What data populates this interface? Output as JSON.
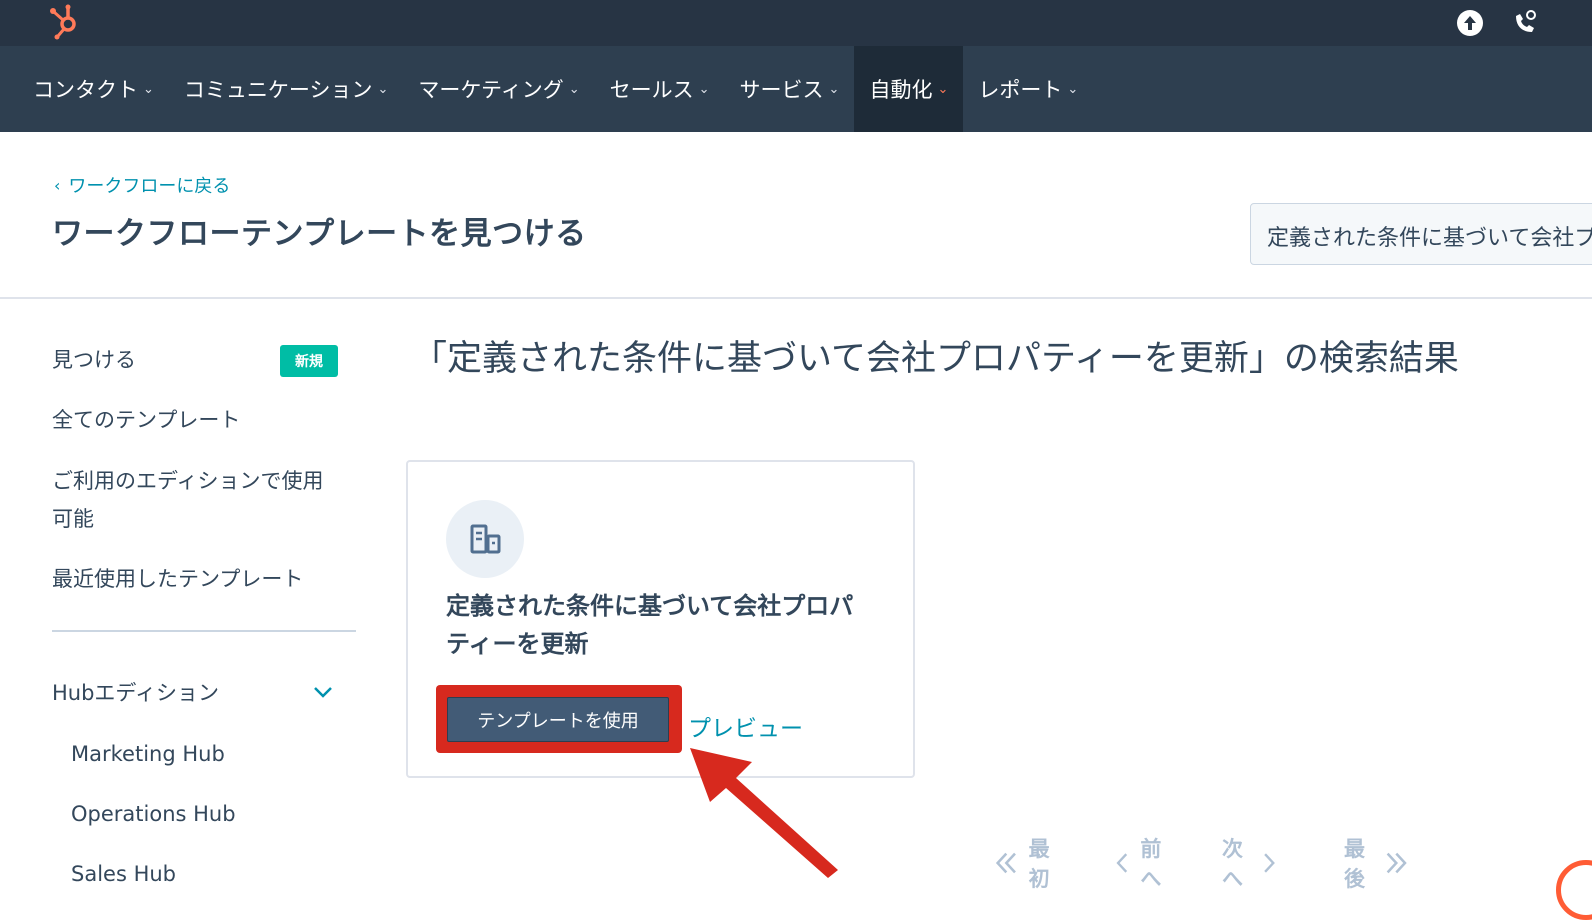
{
  "topbar": {
    "logo_icon": "hubspot-sprocket-icon",
    "upload_icon": "arrow-up-circle-icon",
    "phone_icon": "phone-icon",
    "logo_color": "#ff7a59"
  },
  "nav": {
    "items": [
      {
        "label": "コンタクト"
      },
      {
        "label": "コミュニケーション"
      },
      {
        "label": "マーケティング"
      },
      {
        "label": "セールス"
      },
      {
        "label": "サービス"
      },
      {
        "label": "自動化",
        "active": true
      },
      {
        "label": "レポート"
      }
    ]
  },
  "header": {
    "back_label": "ワークフローに戻る",
    "title": "ワークフローテンプレートを見つける",
    "search_value": "定義された条件に基づいて会社プロパティーを更新"
  },
  "sidebar": {
    "items": [
      {
        "label": "見つける",
        "badge": "新規"
      },
      {
        "label": "全てのテンプレート"
      },
      {
        "label": "ご利用のエディションで使用可能"
      },
      {
        "label": "最近使用したテンプレート"
      }
    ],
    "hub_section": {
      "label": "Hubエディション",
      "items": [
        {
          "label": "Marketing Hub"
        },
        {
          "label": "Operations Hub"
        },
        {
          "label": "Sales Hub"
        }
      ]
    }
  },
  "results": {
    "heading": "「定義された条件に基づいて会社プロパティーを更新」の検索結果",
    "card": {
      "icon": "building-icon",
      "title": "定義された条件に基づいて会社プロパティーを更新",
      "use_button": "テンプレートを使用",
      "preview_link": "プレビュー"
    }
  },
  "pagination": {
    "first": "最初",
    "prev": "前へ",
    "next": "次へ",
    "last": "最後"
  },
  "colors": {
    "topbar": "#273444",
    "navbar": "#2e3f50",
    "accent": "#ff7a59",
    "link": "#0091ae",
    "badge": "#00bda5",
    "highlight": "#d7291e"
  }
}
